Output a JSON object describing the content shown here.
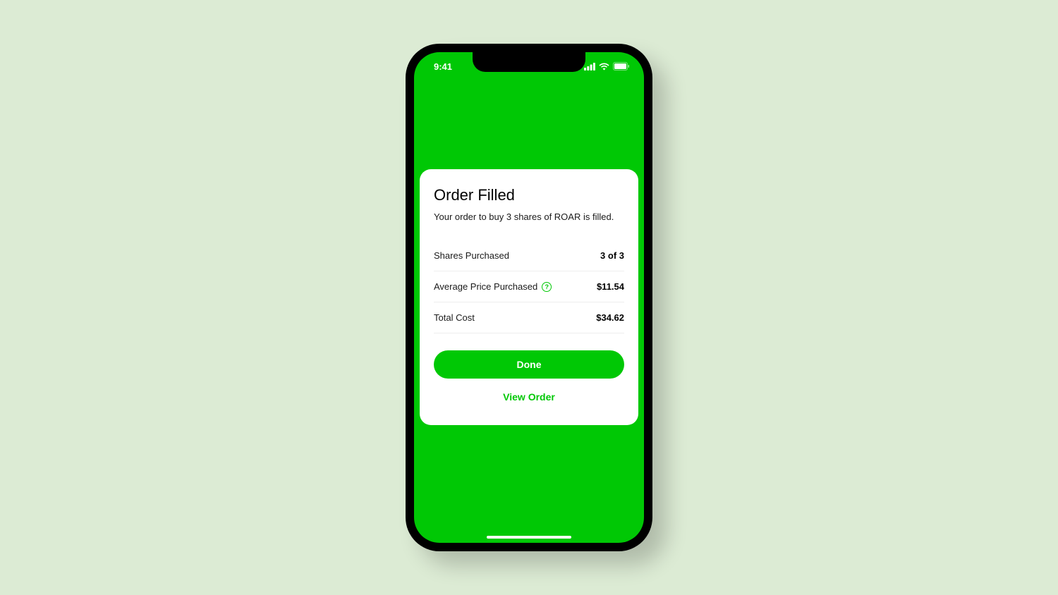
{
  "status_bar": {
    "time": "9:41"
  },
  "card": {
    "title": "Order Filled",
    "subtitle": "Your order to buy 3 shares of ROAR is filled.",
    "rows": [
      {
        "label": "Shares Purchased",
        "value": "3 of 3",
        "info": false
      },
      {
        "label": "Average Price Purchased",
        "value": "$11.54",
        "info": true
      },
      {
        "label": "Total Cost",
        "value": "$34.62",
        "info": false
      }
    ],
    "done_label": "Done",
    "view_order_label": "View Order"
  }
}
